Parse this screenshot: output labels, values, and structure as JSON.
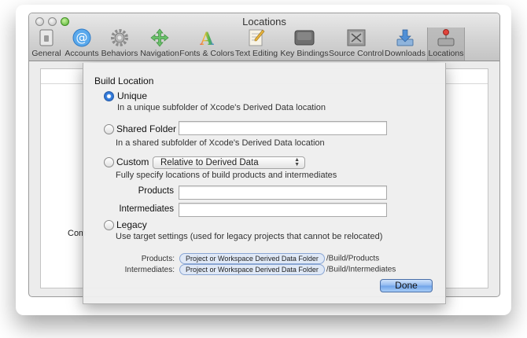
{
  "window": {
    "title": "Locations"
  },
  "toolbar": {
    "items": [
      {
        "label": "General",
        "icon": "general-switch-icon"
      },
      {
        "label": "Accounts",
        "icon": "at-sign-icon"
      },
      {
        "label": "Behaviors",
        "icon": "gear-icon"
      },
      {
        "label": "Navigation",
        "icon": "navigation-arrows-icon"
      },
      {
        "label": "Fonts & Colors",
        "icon": "fonts-colors-icon"
      },
      {
        "label": "Text Editing",
        "icon": "text-editing-icon"
      },
      {
        "label": "Key Bindings",
        "icon": "keyboard-key-icon"
      },
      {
        "label": "Source Control",
        "icon": "source-control-icon"
      },
      {
        "label": "Downloads",
        "icon": "downloads-icon"
      },
      {
        "label": "Locations",
        "icon": "locations-drive-icon"
      }
    ],
    "selected": "Locations"
  },
  "background": {
    "command_text": "Com"
  },
  "sheet": {
    "title": "Build Location",
    "options": {
      "unique": {
        "label": "Unique",
        "desc": "In a unique subfolder of Xcode's Derived Data location",
        "selected": true
      },
      "shared": {
        "label": "Shared Folder",
        "desc": "In a shared subfolder of Xcode's Derived Data location",
        "value": ""
      },
      "custom": {
        "label": "Custom",
        "popup_value": "Relative to Derived Data",
        "desc": "Fully specify locations of build products and intermediates",
        "products_label": "Products",
        "products_value": "",
        "intermediates_label": "Intermediates",
        "intermediates_value": ""
      },
      "legacy": {
        "label": "Legacy",
        "desc": "Use target settings (used for legacy projects that cannot be relocated)"
      }
    },
    "paths": {
      "products": {
        "label": "Products:",
        "token": "Project or Workspace Derived Data Folder",
        "suffix": "/Build/Products"
      },
      "intermediates": {
        "label": "Intermediates:",
        "token": "Project or Workspace Derived Data Folder",
        "suffix": "/Build/Intermediates"
      }
    },
    "done_label": "Done"
  },
  "colors": {
    "accent": "#3a82e0",
    "done_button": "#8fb8ef",
    "token_bg": "#dfe8f6"
  }
}
